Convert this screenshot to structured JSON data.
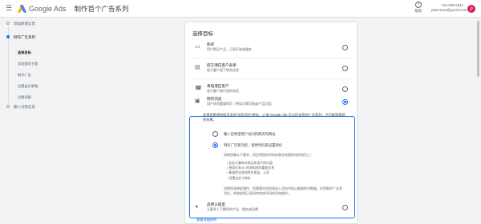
{
  "header": {
    "brand": "Google Ads",
    "title": "制作首个广告系列",
    "help_label": "帮助",
    "account_id": "744-008-5911",
    "account_email": "peter1119@gmail.com",
    "avatar_letter": "p"
  },
  "sidebar": {
    "steps": [
      {
        "label": "添加商家信息"
      },
      {
        "label": "制作广告系列"
      },
      {
        "label": "输入付款信息"
      }
    ],
    "substeps": [
      {
        "label": "选择目标"
      },
      {
        "label": "添加搜索主题"
      },
      {
        "label": "制作广告"
      },
      {
        "label": "设置出价策略"
      },
      {
        "label": "设置预算"
      }
    ]
  },
  "main": {
    "title": "选择目标",
    "options": [
      {
        "icon": "credit-card-icon",
        "title": "购买",
        "desc": "用户购买产品、订阅开放或服务"
      },
      {
        "icon": "form-icon",
        "title": "提交潜在客户表单",
        "desc": "吸引客户留下联系信息"
      },
      {
        "icon": "phone-icon",
        "title": "来电潜在客户",
        "desc": "吸引客户拨打您的电话"
      },
      {
        "icon": "webpage-icon",
        "title": "网页浏览",
        "desc": "用户浏览重要网页（例如文章页面或产品页面）"
      }
    ],
    "selected_explain": "选择您希望的网页浏览\"网页浏览\"转化。让借 Google Ads 可以优化您的广告系列，尽可能提高您的效果。",
    "sub_options": [
      {
        "label": "输入您希望用户访问的网页的网址"
      },
      {
        "label": "制作广告系列后，使用代码来设置转化"
      }
    ],
    "hint": "如果您确认下要求，则应将您的代码安装在有要转化的网页上：",
    "bullets": [
      "此处计算每次购买和用户的价值",
      "使用交易 ID 检测和排除重复交易",
      "衡量转化其他转化收益，以及",
      "设置自定义转化"
    ],
    "after_hint": "如果您选择此操作，您需要在您的网站上添加代码以衡量转化数据。在您制作广告系列后，系统会提示您如何完成代码的添加操作。",
    "last_option": {
      "icon": "megaphone-icon",
      "title": "品牌认知度",
      "desc": "让更多人了解您的产品、服务或品牌"
    },
    "link_label": "查看详细说明"
  }
}
